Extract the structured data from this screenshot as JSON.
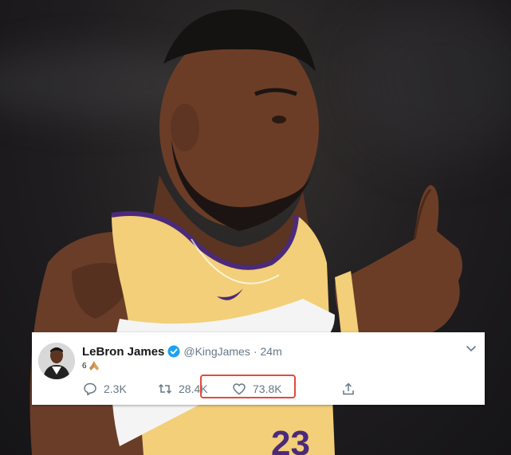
{
  "tweet": {
    "author_name": "LeBron James",
    "handle": "@KingJames",
    "separator": "·",
    "time_ago": "24m",
    "text": "6",
    "emoji": "folded-hands-icon",
    "verified": true,
    "counts": {
      "replies": "2.3K",
      "retweets": "28.4K",
      "likes": "73.8K"
    },
    "icons": {
      "reply": "reply-icon",
      "retweet": "retweet-icon",
      "like": "heart-icon",
      "share": "share-icon",
      "menu": "chevron-down-icon"
    }
  },
  "annotation": {
    "highlight_color": "#e24b3b",
    "highlight_target": "likes"
  },
  "colors": {
    "verified_blue": "#1da1f2",
    "jersey_gold": "#f2cf78",
    "jersey_purple": "#4b2a7b",
    "muted_text": "#657786"
  }
}
